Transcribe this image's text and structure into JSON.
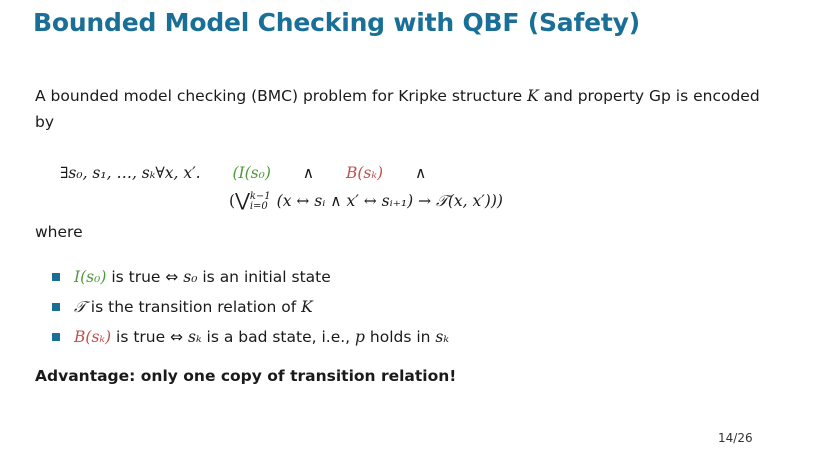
{
  "slide": {
    "title": "Bounded Model Checking with QBF (Safety)",
    "intro_line1": "A bounded model checking (BMC) problem for Kripke structure ",
    "intro_K": "K",
    "intro_mid": " and property Gp is encoded",
    "intro_line2": "by",
    "formula_prefix": "∃s₀, s₁, …, sₖ∀x, x′.",
    "formula_I": "(I(s₀)",
    "formula_and1": "∧",
    "formula_B": "B(sₖ)",
    "formula_and2": "∧",
    "formula_open": "(",
    "formula_bigor": "⋁",
    "formula_upper": "k−1",
    "formula_lower": "i=0",
    "formula_rest": "(x ↔ sᵢ ∧ x′ ↔ sᵢ₊₁) → 𝒯(x, x′)))",
    "where": "where",
    "bullets": [
      {
        "math": "I(s₀)",
        "text": " is true ⇔ ",
        "math2": "s₀",
        "text2": " is an initial state",
        "color": "#4e9a3a"
      },
      {
        "math": "𝒯",
        "text": " is the transition relation of ",
        "math2": "K",
        "text2": "",
        "color": ""
      },
      {
        "math": "B(sₖ)",
        "text": " is true ⇔ ",
        "math2": "sₖ",
        "text2": " is a bad state, i.e., ",
        "math3": "p",
        "text3": " holds in ",
        "math4": "sₖ",
        "color": "#c0504d"
      }
    ],
    "advantage": "Advantage: only one copy of transition relation!",
    "page_number": "14/26",
    "accent_color": "#1a6f96"
  }
}
